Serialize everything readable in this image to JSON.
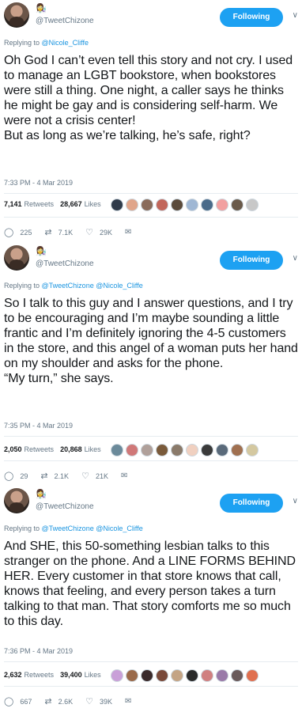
{
  "tweets": [
    {
      "badge": "👩‍🔬",
      "handle": "@TweetChizone",
      "follow_label": "Following",
      "reply_prefix": "Replying to ",
      "reply_to": "@Nicole_Cliffe",
      "text": "Oh God I can’t even tell this story and not cry. I used to manage an LGBT bookstore, when bookstores were still a thing. One night, a caller says he thinks he might be gay and is considering self-harm. We were not a crisis center!\nBut as long as we’re talking, he’s safe, right?",
      "time": "7:33 PM - 4 Mar 2019",
      "retweets_count": "7,141",
      "retweets_label": "Retweets",
      "likes_count": "28,667",
      "likes_label": "Likes",
      "replies": "225",
      "rt": "7.1K",
      "likes": "29K"
    },
    {
      "badge": "👩‍🔬",
      "handle": "@TweetChizone",
      "follow_label": "Following",
      "reply_prefix": "Replying to ",
      "reply_to": "@TweetChizone @Nicole_Cliffe",
      "text": "So I talk to this guy and I answer questions, and I try to be encouraging and I’m maybe sounding a little frantic and I’m definitely ignoring the 4-5 customers in the store, and this angel of a woman puts her hand on my shoulder and asks for the phone.\n“My turn,” she says.",
      "time": "7:35 PM - 4 Mar 2019",
      "retweets_count": "2,050",
      "retweets_label": "Retweets",
      "likes_count": "20,868",
      "likes_label": "Likes",
      "replies": "29",
      "rt": "2.1K",
      "likes": "21K"
    },
    {
      "badge": "👩‍🔬",
      "handle": "@TweetChizone",
      "follow_label": "Following",
      "reply_prefix": "Replying to ",
      "reply_to": "@TweetChizone @Nicole_Cliffe",
      "text": "And SHE, this 50-something lesbian talks to this stranger on the phone. And a LINE FORMS BEHIND HER. Every customer in that store knows that call, knows that feeling, and every person takes a turn talking to that man. That story comforts me so much to this day.",
      "time": "7:36 PM - 4 Mar 2019",
      "retweets_count": "2,632",
      "retweets_label": "Retweets",
      "likes_count": "39,400",
      "likes_label": "Likes",
      "replies": "667",
      "rt": "2.6K",
      "likes": "39K"
    }
  ],
  "icons": {
    "reply": "reply-icon",
    "retweet": "retweet-icon",
    "like": "heart-icon",
    "dm": "mail-icon",
    "caret": "chevron-down-icon"
  },
  "colors": {
    "accent": "#1da1f2",
    "link": "#1b95e0",
    "muted": "#657786"
  },
  "face_colors": [
    [
      "#2f3b4a",
      "#e0a58a",
      "#8a6b5a",
      "#c2665a",
      "#5b4b3b",
      "#9fb7d4",
      "#4a6b8a",
      "#f2a0a0",
      "#6a5a4a",
      "#c8c8c8"
    ],
    [
      "#6b8a9a",
      "#d07878",
      "#b0a09a",
      "#7a5a3a",
      "#8a7a6a",
      "#f0d0c0",
      "#3a3a3a",
      "#5a6a7a",
      "#a07050",
      "#d4c8a0"
    ],
    [
      "#c9a0d8",
      "#9a6a4a",
      "#3a2a2a",
      "#7a4a3a",
      "#c4a484",
      "#2a2a2a",
      "#d08080",
      "#9a7aa8",
      "#6a5a5a",
      "#e07050"
    ]
  ]
}
